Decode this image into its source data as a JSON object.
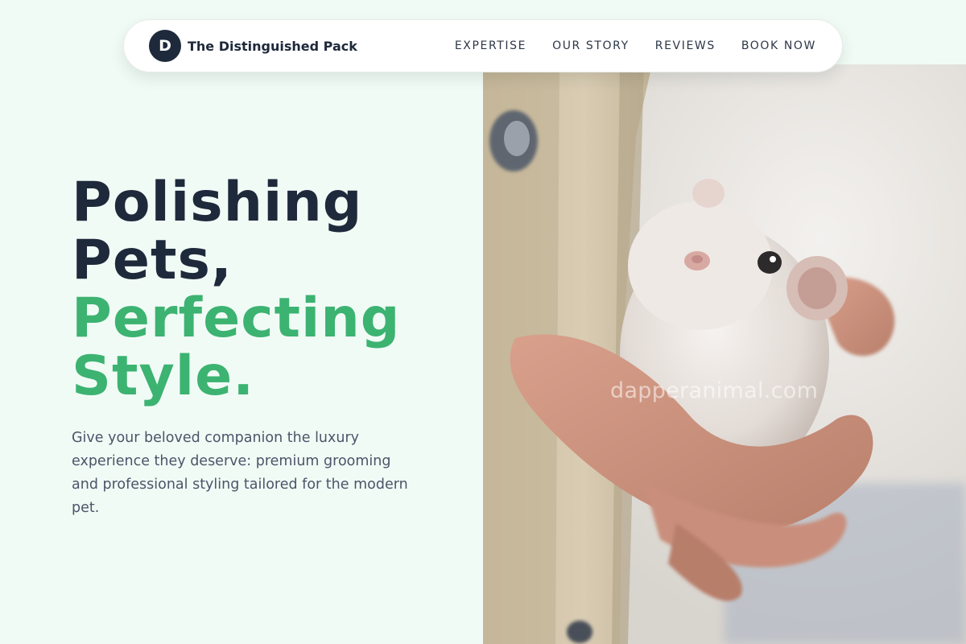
{
  "brand": {
    "logo_letter": "D",
    "name": "The Distinguished Pack"
  },
  "nav": {
    "links": [
      "EXPERTISE",
      "OUR STORY",
      "REVIEWS",
      "BOOK NOW"
    ]
  },
  "hero": {
    "headline_line1": "Polishing",
    "headline_line2": "Pets,",
    "headline_line3": "Perfecting",
    "headline_line4": "Style.",
    "subtext": "Give your beloved companion the luxury experience they deserve: premium grooming and professional styling tailored for the modern pet.",
    "image_watermark": "dapperanimal.com",
    "image_subject": "hamster-in-hand-photo"
  },
  "colors": {
    "background": "#f1fbf6",
    "primary_dark": "#1e293b",
    "accent_green": "#3cb371",
    "body_text": "#4a5568"
  }
}
